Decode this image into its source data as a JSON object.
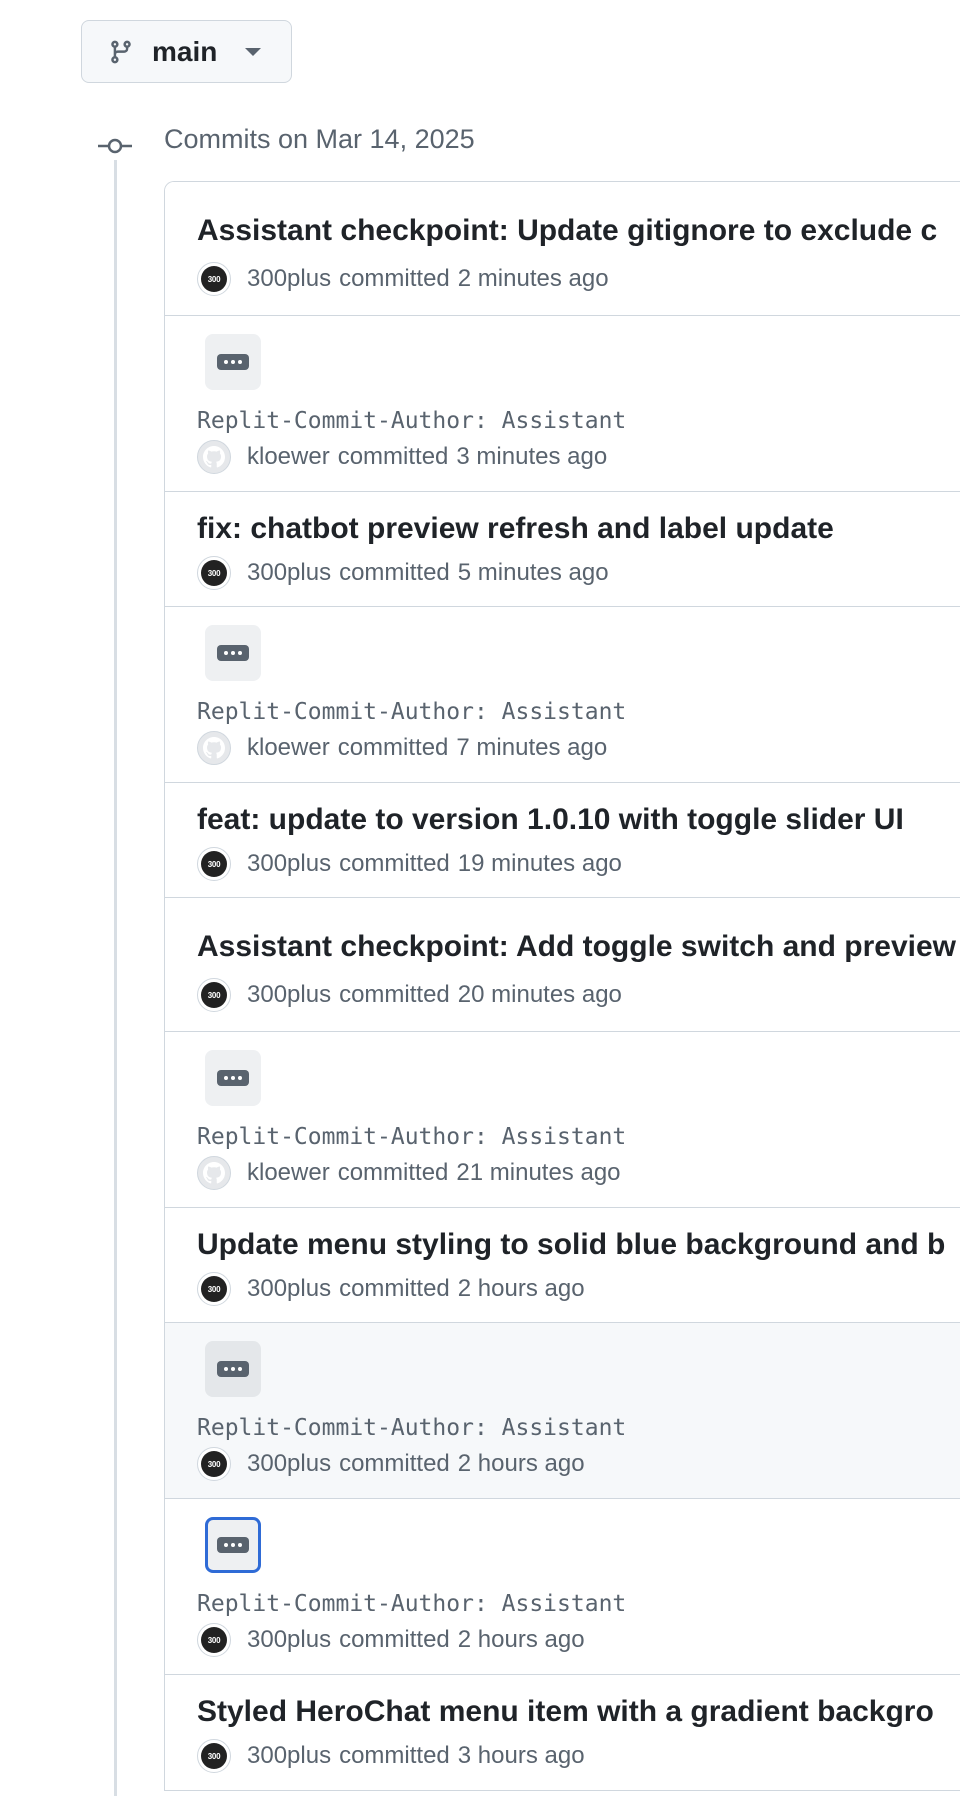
{
  "branch": {
    "label": "main"
  },
  "group": {
    "title": "Commits on Mar 14, 2025"
  },
  "commits": [
    {
      "type": "title",
      "title": "Assistant checkpoint: Update gitignore to exclude c",
      "author": "300plus",
      "action": "committed",
      "ago": "2 minutes ago",
      "avatar": "300"
    },
    {
      "type": "message",
      "message": "Replit-Commit-Author: Assistant",
      "author": "kloewer",
      "action": "committed",
      "ago": "3 minutes ago",
      "avatar": "github"
    },
    {
      "type": "title",
      "title": "fix: chatbot preview refresh and label update",
      "author": "300plus",
      "action": "committed",
      "ago": "5 minutes ago",
      "avatar": "300"
    },
    {
      "type": "message",
      "message": "Replit-Commit-Author: Assistant",
      "author": "kloewer",
      "action": "committed",
      "ago": "7 minutes ago",
      "avatar": "github"
    },
    {
      "type": "title",
      "title": "feat: update to version 1.0.10 with toggle slider UI",
      "author": "300plus",
      "action": "committed",
      "ago": "19 minutes ago",
      "avatar": "300"
    },
    {
      "type": "title",
      "title": "Assistant checkpoint: Add toggle switch and preview",
      "author": "300plus",
      "action": "committed",
      "ago": "20 minutes ago",
      "avatar": "300"
    },
    {
      "type": "message",
      "message": "Replit-Commit-Author: Assistant",
      "author": "kloewer",
      "action": "committed",
      "ago": "21 minutes ago",
      "avatar": "github"
    },
    {
      "type": "title",
      "title": "Update menu styling to solid blue background and b",
      "author": "300plus",
      "action": "committed",
      "ago": "2 hours ago",
      "avatar": "300"
    },
    {
      "type": "message",
      "message": "Replit-Commit-Author: Assistant",
      "author": "300plus",
      "action": "committed",
      "ago": "2 hours ago",
      "avatar": "300"
    },
    {
      "type": "message",
      "message": "Replit-Commit-Author: Assistant",
      "author": "300plus",
      "action": "committed",
      "ago": "2 hours ago",
      "avatar": "300"
    },
    {
      "type": "title",
      "title": "Styled HeroChat menu item with a gradient backgro",
      "author": "300plus",
      "action": "committed",
      "ago": "3 hours ago",
      "avatar": "300"
    }
  ],
  "avatar_text": "300",
  "colors": {
    "accent": "#2f6bd6",
    "muted": "#59636e",
    "border": "#d0d7de"
  }
}
